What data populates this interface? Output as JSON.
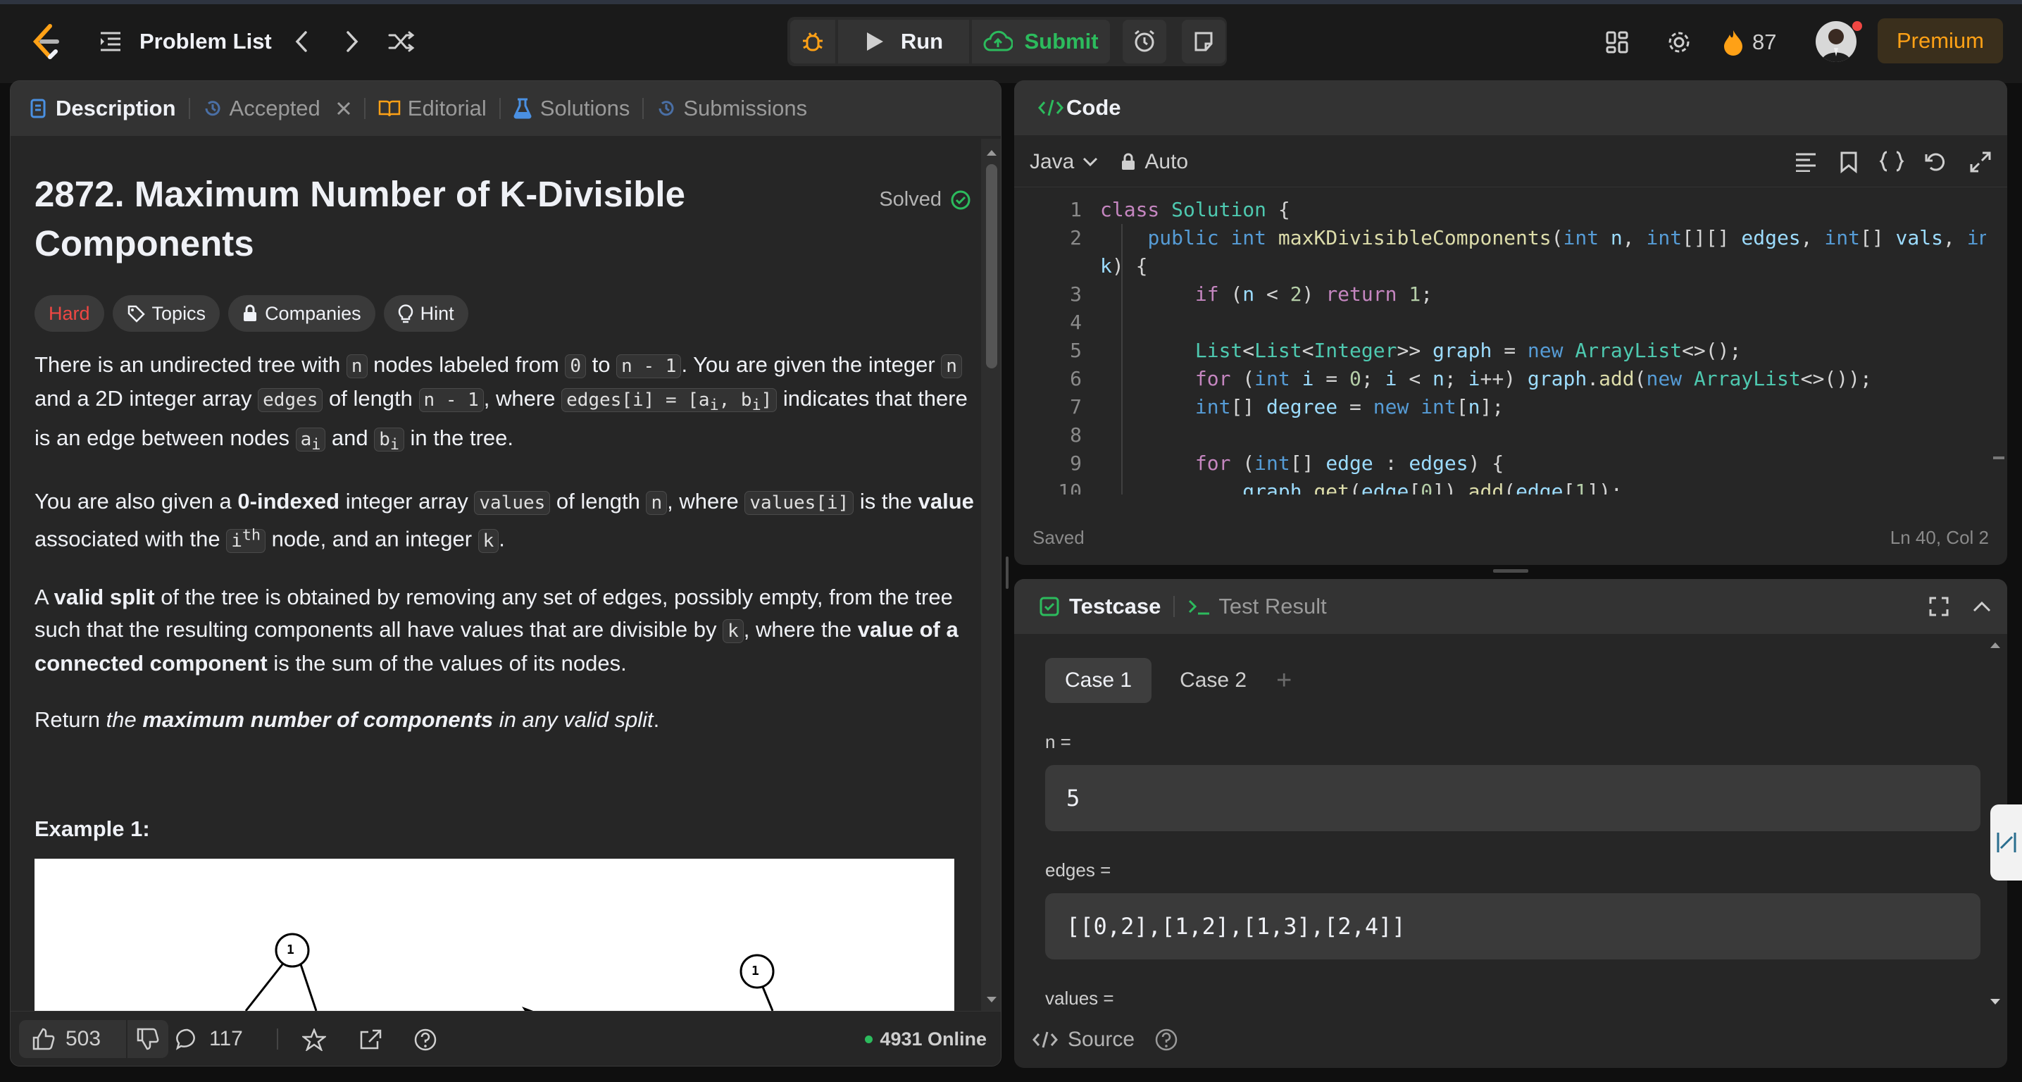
{
  "topbar": {
    "problem_list_label": "Problem List",
    "run_label": "Run",
    "submit_label": "Submit",
    "streak_count": "87",
    "premium_label": "Premium"
  },
  "description": {
    "tabs": [
      "Description",
      "Accepted",
      "Editorial",
      "Solutions",
      "Submissions"
    ],
    "title_line1": "2872. Maximum Number of K-Divisible",
    "title_line2": "Components",
    "solved_label": "Solved",
    "difficulty": "Hard",
    "chips": [
      "Topics",
      "Companies",
      "Hint"
    ],
    "example_heading": "Example 1:",
    "likes": "503",
    "comments": "117",
    "online": "4931 Online"
  },
  "code": {
    "title": "Code",
    "language": "Java",
    "mode": "Auto",
    "status": "Saved",
    "cursor": "Ln 40, Col 2",
    "line_numbers": [
      "1",
      "2",
      "",
      "3",
      "4",
      "5",
      "6",
      "7",
      "8",
      "9",
      "10"
    ]
  },
  "testcase": {
    "tab_testcase": "Testcase",
    "tab_result": "Test Result",
    "cases": [
      "Case 1",
      "Case 2"
    ],
    "add_symbol": "+",
    "fields": [
      {
        "label": "n =",
        "value": "5"
      },
      {
        "label": "edges =",
        "value": "[[0,2],[1,2],[1,3],[2,4]]"
      },
      {
        "label": "values =",
        "value": ""
      }
    ],
    "source_label": "Source"
  },
  "example_nodes": [
    "1",
    "1"
  ],
  "colors": {
    "accent_green": "#2cbb5d",
    "hard_red": "#ef4743",
    "premium_orange": "#ffa116",
    "panel_bg": "#262626"
  }
}
